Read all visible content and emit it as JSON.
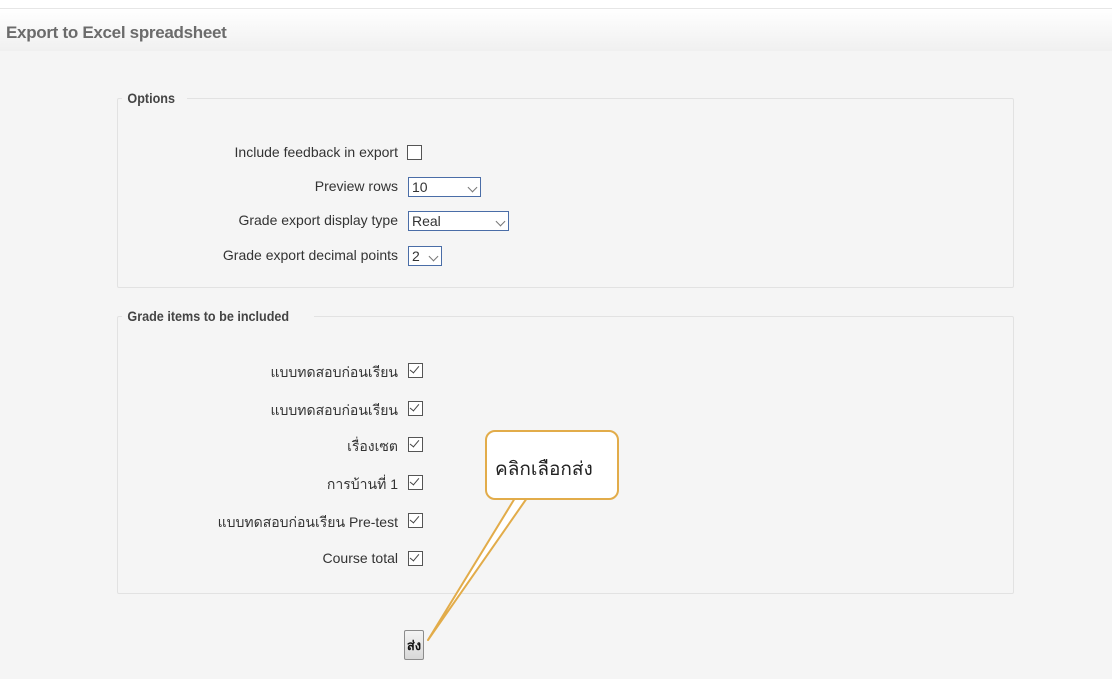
{
  "page": {
    "title": "Export to Excel spreadsheet"
  },
  "options": {
    "legend": "Options",
    "include_feedback": {
      "label": "Include feedback in export",
      "checked": false
    },
    "preview_rows": {
      "label": "Preview rows",
      "value": "10"
    },
    "display_type": {
      "label": "Grade export display type",
      "value": "Real"
    },
    "decimal_points": {
      "label": "Grade export decimal points",
      "value": "2"
    }
  },
  "grade_items": {
    "legend": "Grade items to be included",
    "items": [
      {
        "label": "แบบทดสอบก่อนเรียน",
        "checked": true
      },
      {
        "label": "แบบทดสอบก่อนเรียน",
        "checked": true
      },
      {
        "label": "เรื่องเซต",
        "checked": true
      },
      {
        "label": "การบ้านที่ 1",
        "checked": true
      },
      {
        "label": "แบบทดสอบก่อนเรียน Pre-test",
        "checked": true
      },
      {
        "label": "Course total",
        "checked": true
      }
    ]
  },
  "submit": {
    "label": "ส่ง"
  },
  "callout": {
    "text": "คลิกเลือกส่ง",
    "border_color": "#e2ac4a"
  }
}
